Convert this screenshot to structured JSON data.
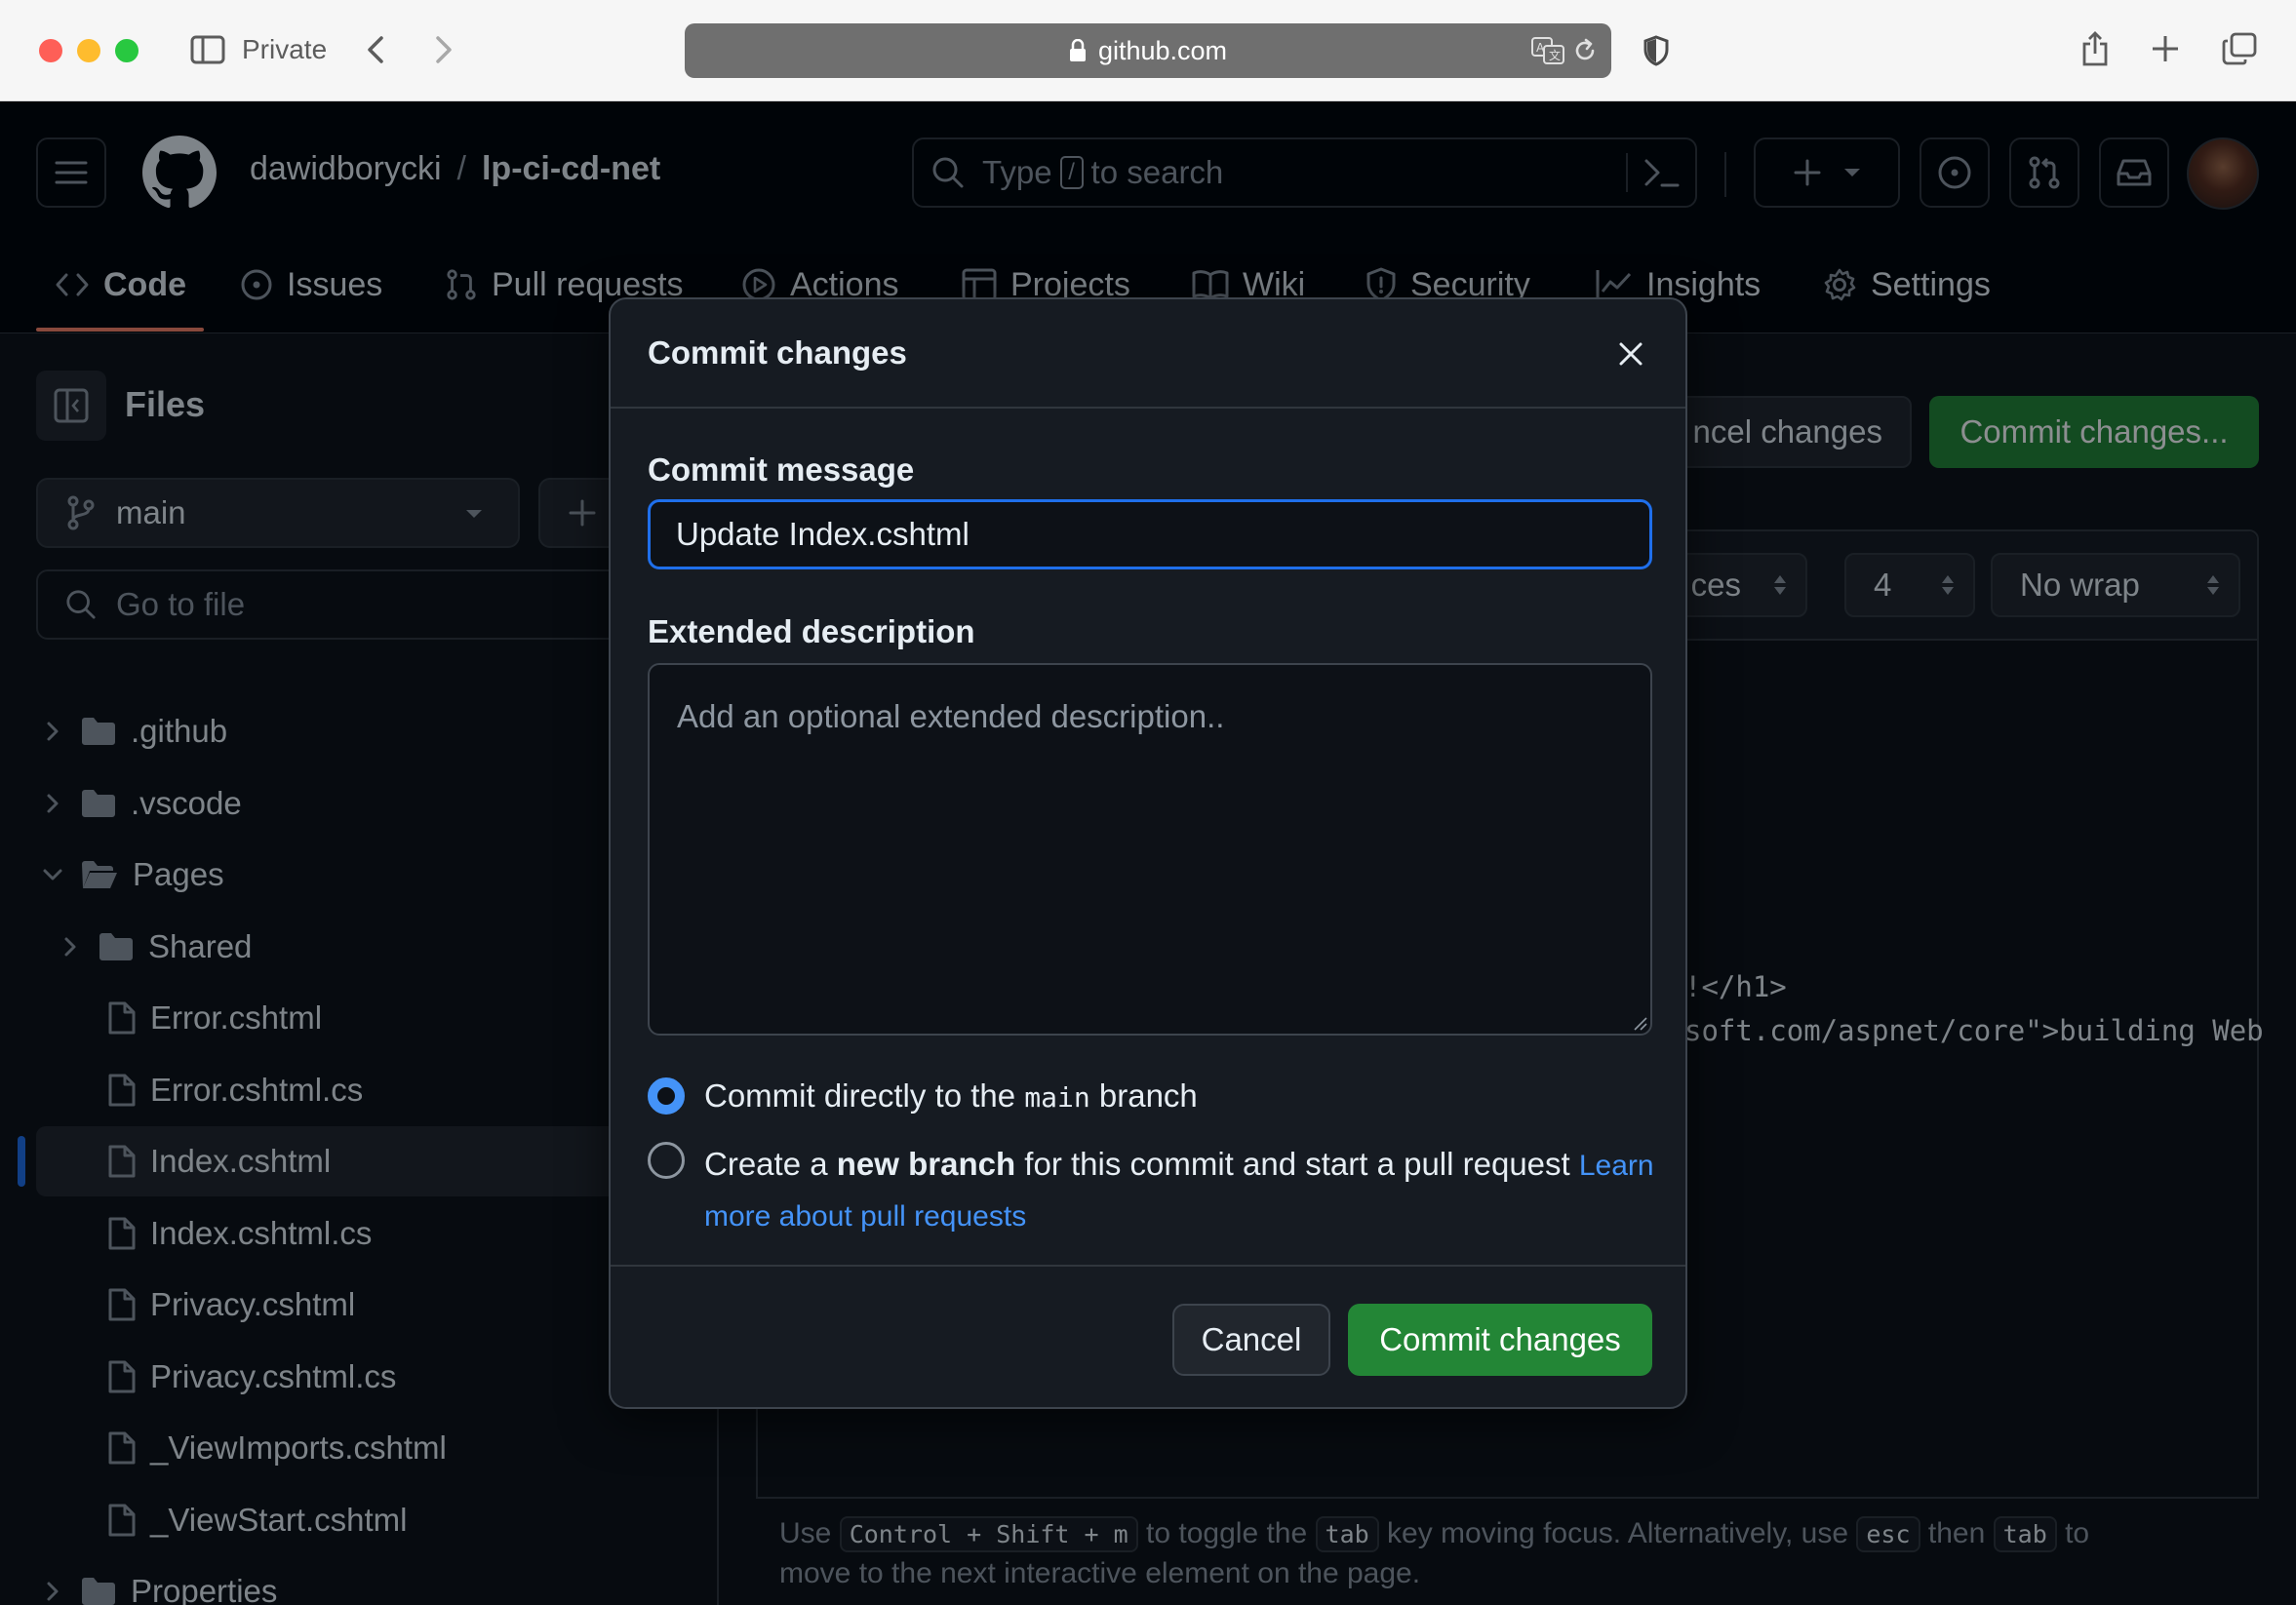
{
  "browser": {
    "mode_label": "Private",
    "url": "github.com"
  },
  "repo": {
    "owner": "dawidborycki",
    "separator": "/",
    "name": "lp-ci-cd-net"
  },
  "search": {
    "prefix": "Type",
    "key": "/",
    "suffix": "to search"
  },
  "tabs": [
    {
      "label": "Code",
      "icon": "code-icon"
    },
    {
      "label": "Issues",
      "icon": "issue-icon"
    },
    {
      "label": "Pull requests",
      "icon": "pull-request-icon"
    },
    {
      "label": "Actions",
      "icon": "play-icon"
    },
    {
      "label": "Projects",
      "icon": "table-icon"
    },
    {
      "label": "Wiki",
      "icon": "book-icon"
    },
    {
      "label": "Security",
      "icon": "shield-icon"
    },
    {
      "label": "Insights",
      "icon": "graph-icon"
    },
    {
      "label": "Settings",
      "icon": "gear-icon"
    }
  ],
  "sidebar": {
    "title": "Files",
    "branch": "main",
    "goto_placeholder": "Go to file",
    "tree": [
      {
        "label": ".github",
        "type": "folder",
        "state": "collapsed"
      },
      {
        "label": ".vscode",
        "type": "folder",
        "state": "collapsed"
      },
      {
        "label": "Pages",
        "type": "folder",
        "state": "expanded"
      },
      {
        "label": "Shared",
        "type": "folder",
        "state": "collapsed"
      },
      {
        "label": "Error.cshtml",
        "type": "file"
      },
      {
        "label": "Error.cshtml.cs",
        "type": "file"
      },
      {
        "label": "Index.cshtml",
        "type": "file",
        "selected": true
      },
      {
        "label": "Index.cshtml.cs",
        "type": "file"
      },
      {
        "label": "Privacy.cshtml",
        "type": "file"
      },
      {
        "label": "Privacy.cshtml.cs",
        "type": "file"
      },
      {
        "label": "_ViewImports.cshtml",
        "type": "file"
      },
      {
        "label": "_ViewStart.cshtml",
        "type": "file"
      },
      {
        "label": "Properties",
        "type": "folder",
        "state": "collapsed"
      }
    ]
  },
  "editor": {
    "cancel_label": "ncel changes",
    "commit_label": "Commit changes...",
    "indent_mode": "ces",
    "indent_size": "4",
    "wrap_mode": "No wrap",
    "code_lines": [
      "!</h1>",
      "soft.com/aspnet/core\">building Web"
    ],
    "help": {
      "t1": "Use",
      "k1": "Control + Shift + m",
      "t2": "to toggle the",
      "k2": "tab",
      "t3": "key moving focus. Alternatively, use",
      "k3": "esc",
      "t4": "then",
      "k4": "tab",
      "t5": "to",
      "t6": "move to the next interactive element on the page."
    }
  },
  "modal": {
    "title": "Commit changes",
    "message_label": "Commit message",
    "message_value": "Update Index.cshtml",
    "description_label": "Extended description",
    "description_placeholder": "Add an optional extended description..",
    "option_direct": {
      "pre": "Commit directly to the",
      "branch": "main",
      "post": "branch",
      "selected": true
    },
    "option_new": {
      "pre": "Create a",
      "bold": "new branch",
      "post": "for this commit and start a pull request",
      "link_a": "Learn",
      "link_b": "more about pull requests",
      "selected": false
    },
    "cancel_label": "Cancel",
    "commit_label": "Commit changes"
  },
  "colors": {
    "accent_blue": "#4493f8",
    "primary_green": "#238636",
    "tab_underline": "#f78166"
  }
}
